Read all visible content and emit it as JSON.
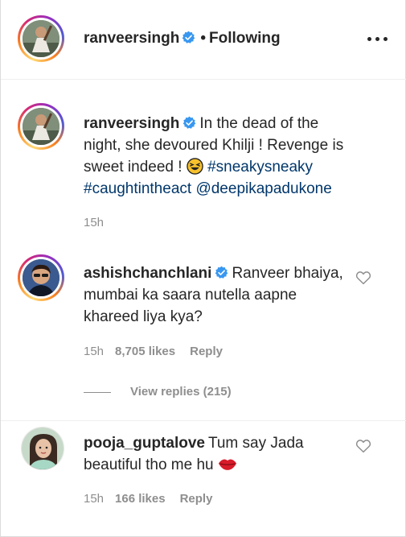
{
  "header": {
    "username": "ranveersingh",
    "separator": "•",
    "following_label": "Following"
  },
  "caption": {
    "username": "ranveersingh",
    "text": "In the dead of the night, she devoured Khilji ! Revenge is sweet indeed !",
    "emoji": "laughing-face",
    "hashtag1": "#sneakysneaky",
    "hashtag2": "#caughtintheact",
    "mention": "@deepikapadukone",
    "time": "15h"
  },
  "comments": [
    {
      "username": "ashishchanchlani",
      "text": "Ranveer bhaiya, mumbai ka saara nutella aapne khareed liya kya?",
      "time": "15h",
      "likes": "8,705 likes",
      "reply_label": "Reply",
      "view_replies": "View replies (215)"
    },
    {
      "username": "pooja_guptalove",
      "text": "Tum say Jada beautiful tho me hu",
      "emoji": "lips",
      "time": "15h",
      "likes": "166 likes",
      "reply_label": "Reply"
    }
  ],
  "colors": {
    "text": "#262626",
    "secondary": "#8e8e8e",
    "link": "#00376b",
    "verified": "#3897f0"
  }
}
